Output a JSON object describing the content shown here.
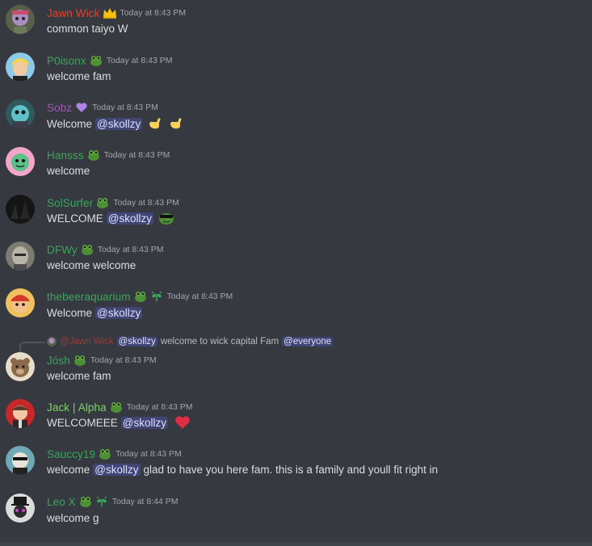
{
  "colors": {
    "background": "#36393f",
    "text": "#dcddde",
    "timestamp": "#a3a6aa",
    "mention_bg": "rgba(88,101,242,0.3)",
    "mention_text": "#dee0fc",
    "red_role": "#e8402f",
    "green_role": "#3ba55c",
    "purple_role": "#9b59b6",
    "light_green_role": "#7fd36b"
  },
  "messages": [
    {
      "author": "Jawn Wick",
      "author_color": "#e8402f",
      "badges": [
        "crown-icon"
      ],
      "timestamp": "Today at 8:43 PM",
      "content": [
        {
          "type": "text",
          "text": "common taiyo W"
        }
      ]
    },
    {
      "author": "P0isonx",
      "author_color": "#3ba55c",
      "badges": [
        "frog-badge-icon"
      ],
      "timestamp": "Today at 8:43 PM",
      "content": [
        {
          "type": "text",
          "text": "welcome fam"
        }
      ]
    },
    {
      "author": "Sobz",
      "author_color": "#9b59b6",
      "badges": [
        "purple-heart-icon"
      ],
      "timestamp": "Today at 8:43 PM",
      "content": [
        {
          "type": "text",
          "text": "Welcome"
        },
        {
          "type": "mention",
          "text": "@skollzy"
        },
        {
          "type": "emoji",
          "name": "call-me-hand-emoji"
        },
        {
          "type": "emoji",
          "name": "call-me-hand-emoji"
        }
      ]
    },
    {
      "author": "Hansss",
      "author_color": "#3ba55c",
      "badges": [
        "frog-badge-icon"
      ],
      "timestamp": "Today at 8:43 PM",
      "content": [
        {
          "type": "text",
          "text": "welcome"
        }
      ]
    },
    {
      "author": "SolSurfer",
      "author_color": "#3ba55c",
      "badges": [
        "frog-badge-icon"
      ],
      "timestamp": "Today at 8:43 PM",
      "content": [
        {
          "type": "text",
          "text": "WELCOME"
        },
        {
          "type": "mention",
          "text": "@skollzy"
        },
        {
          "type": "emoji",
          "name": "frog-sunglasses-emoji"
        }
      ]
    },
    {
      "author": "DFWy",
      "author_color": "#3ba55c",
      "badges": [
        "frog-badge-icon"
      ],
      "timestamp": "Today at 8:43 PM",
      "content": [
        {
          "type": "text",
          "text": "welcome welcome"
        }
      ]
    },
    {
      "author": "thebeeraquarium",
      "author_color": "#3ba55c",
      "badges": [
        "frog-badge-icon",
        "sprout-icon"
      ],
      "timestamp": "Today at 8:43 PM",
      "content": [
        {
          "type": "text",
          "text": "Welcome"
        },
        {
          "type": "mention",
          "text": "@skollzy"
        }
      ]
    },
    {
      "reply": {
        "author": "@Jawn Wick",
        "mention": "@skollzy",
        "text": "welcome to wick capital Fam",
        "mention2": "@everyone"
      },
      "author": "Jósh",
      "author_color": "#3ba55c",
      "badges": [
        "frog-badge-icon"
      ],
      "timestamp": "Today at 8:43 PM",
      "content": [
        {
          "type": "text",
          "text": "welcome fam"
        }
      ]
    },
    {
      "author": "Jack | Alpha",
      "author_color": "#7fd36b",
      "badges": [
        "frog-badge-icon"
      ],
      "timestamp": "Today at 8:43 PM",
      "content": [
        {
          "type": "text",
          "text": "WELCOMEEE"
        },
        {
          "type": "mention",
          "text": "@skollzy"
        },
        {
          "type": "emoji",
          "name": "red-heart-emoji"
        }
      ]
    },
    {
      "author": "Sauccy19",
      "author_color": "#3ba55c",
      "badges": [
        "frog-badge-icon"
      ],
      "timestamp": "Today at 8:43 PM",
      "content": [
        {
          "type": "text",
          "text": "welcome"
        },
        {
          "type": "mention",
          "text": "@skollzy"
        },
        {
          "type": "text",
          "text": "glad to have you here fam. this is a family and youll fit right in"
        }
      ]
    },
    {
      "author": "Leo X",
      "author_color": "#3ba55c",
      "badges": [
        "frog-badge-icon",
        "sprout-icon"
      ],
      "timestamp": "Today at 8:44 PM",
      "content": [
        {
          "type": "text",
          "text": "welcome g"
        }
      ]
    }
  ]
}
